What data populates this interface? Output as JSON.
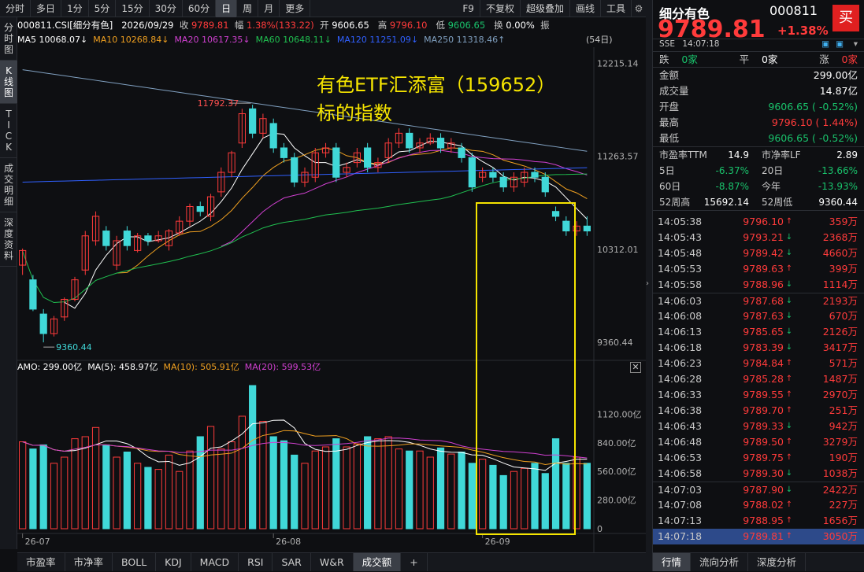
{
  "toolbar": {
    "tabs": [
      "分时",
      "多日",
      "1分",
      "5分",
      "15分",
      "30分",
      "60分",
      "日",
      "周",
      "月",
      "更多"
    ],
    "active_tab": "日",
    "right_items": [
      "F9",
      "不复权",
      "超级叠加",
      "画线",
      "工具"
    ]
  },
  "left_tabs": [
    "分时图",
    "K线图",
    "TICK",
    "成交明细",
    "深度资料"
  ],
  "info": {
    "code_name": "000811.CSI[细分有色]",
    "date": "2026/09/29",
    "close_label": "收",
    "close": "9789.81",
    "change_label": "幅",
    "change": "1.38%(133.22)",
    "open_label": "开",
    "open": "9606.65",
    "high_label": "高",
    "high": "9796.10",
    "low_label": "低",
    "low": "9606.65",
    "turnover_label": "换",
    "turnover": "0.00%",
    "amp_label": "振"
  },
  "ma": {
    "ma5": "MA5 10068.07↓",
    "ma10": "MA10 10268.84↓",
    "ma20": "MA20 10617.35↓",
    "ma60": "MA60 10648.11↓",
    "ma120": "MA120 11251.09↓",
    "ma250": "MA250 11318.46↑",
    "days": "(54日)"
  },
  "price_axis": [
    "12215.14",
    "11263.57",
    "10312.01",
    "9360.44"
  ],
  "high_mark": "11792.37",
  "low_mark": "9360.44",
  "amo": {
    "amo": "AMO: 299.00亿",
    "ma5": "MA(5): 458.97亿",
    "ma10": "MA(10): 505.91亿",
    "ma20": "MA(20): 599.53亿"
  },
  "vol_axis": [
    "1120.00亿",
    "840.00亿",
    "560.00亿",
    "280.00亿",
    "0"
  ],
  "date_axis": [
    "26-07",
    "26-08",
    "26-09"
  ],
  "annotation": {
    "line1": "有色ETF汇添富（159652）",
    "line2": "标的指数"
  },
  "bottom_tabs": [
    "市盈率",
    "市净率",
    "BOLL",
    "KDJ",
    "MACD",
    "RSI",
    "SAR",
    "W&R",
    "成交额"
  ],
  "colors": {
    "up": "#ff3b3b",
    "down": "#40d8d8",
    "ma5": "#ffffff",
    "ma10": "#f0a020",
    "ma20": "#d040d0",
    "ma60": "#20c050",
    "ma120": "#3060ff",
    "ma250": "#80a0c0",
    "highlight": "#f5e400"
  },
  "quote": {
    "name": "细分有色",
    "code": "000811",
    "price": "9789.81",
    "pct": "+1.38%",
    "buy": "买",
    "market": "SSE",
    "time": "14:07:18",
    "breadth": {
      "down_label": "跌",
      "down": "0家",
      "flat_label": "平",
      "flat": "0家",
      "up_label": "涨",
      "up": "0家"
    },
    "rows": [
      {
        "label": "金额",
        "value": "299.00亿",
        "cls": "white"
      },
      {
        "label": "成交量",
        "value": "14.87亿",
        "cls": "white"
      },
      {
        "label": "开盘",
        "value": "9606.65 ( -0.52%)",
        "cls": "green"
      },
      {
        "label": "最高",
        "value": "9796.10 ( 1.44%)",
        "cls": "red"
      },
      {
        "label": "最低",
        "value": "9606.65 ( -0.52%)",
        "cls": "green"
      }
    ],
    "stats": [
      {
        "l1": "市盈率TTM",
        "v1": "14.9",
        "c1": "white",
        "l2": "市净率LF",
        "v2": "2.89",
        "c2": "white"
      },
      {
        "l1": "5日",
        "v1": "-6.37%",
        "c1": "green",
        "l2": "20日",
        "v2": "-13.66%",
        "c2": "green"
      },
      {
        "l1": "60日",
        "v1": "-8.87%",
        "c1": "green",
        "l2": "今年",
        "v2": "-13.93%",
        "c2": "green"
      },
      {
        "l1": "52周高",
        "v1": "15692.14",
        "c1": "white",
        "l2": "52周低",
        "v2": "9360.44",
        "c2": "white"
      }
    ],
    "ticks": [
      {
        "t": "14:05:38",
        "p": "9796.10",
        "d": "up",
        "v": "359万"
      },
      {
        "t": "14:05:43",
        "p": "9793.21",
        "d": "down",
        "v": "2368万"
      },
      {
        "t": "14:05:48",
        "p": "9789.42",
        "d": "down",
        "v": "4660万"
      },
      {
        "t": "14:05:53",
        "p": "9789.63",
        "d": "up",
        "v": "399万"
      },
      {
        "t": "14:05:58",
        "p": "9788.96",
        "d": "down",
        "v": "1114万"
      },
      {
        "t": "14:06:03",
        "p": "9787.68",
        "d": "down",
        "v": "2193万"
      },
      {
        "t": "14:06:08",
        "p": "9787.63",
        "d": "down",
        "v": "670万"
      },
      {
        "t": "14:06:13",
        "p": "9785.65",
        "d": "down",
        "v": "2126万"
      },
      {
        "t": "14:06:18",
        "p": "9783.39",
        "d": "down",
        "v": "3417万"
      },
      {
        "t": "14:06:23",
        "p": "9784.84",
        "d": "up",
        "v": "571万"
      },
      {
        "t": "14:06:28",
        "p": "9785.28",
        "d": "up",
        "v": "1487万"
      },
      {
        "t": "14:06:33",
        "p": "9789.55",
        "d": "up",
        "v": "2970万"
      },
      {
        "t": "14:06:38",
        "p": "9789.70",
        "d": "up",
        "v": "251万"
      },
      {
        "t": "14:06:43",
        "p": "9789.33",
        "d": "down",
        "v": "942万"
      },
      {
        "t": "14:06:48",
        "p": "9789.50",
        "d": "up",
        "v": "3279万"
      },
      {
        "t": "14:06:53",
        "p": "9789.75",
        "d": "up",
        "v": "190万"
      },
      {
        "t": "14:06:58",
        "p": "9789.30",
        "d": "down",
        "v": "1038万"
      },
      {
        "t": "14:07:03",
        "p": "9787.90",
        "d": "down",
        "v": "2422万"
      },
      {
        "t": "14:07:08",
        "p": "9788.02",
        "d": "up",
        "v": "227万"
      },
      {
        "t": "14:07:13",
        "p": "9788.95",
        "d": "up",
        "v": "1656万"
      },
      {
        "t": "14:07:18",
        "p": "9789.81",
        "d": "up",
        "v": "3050万"
      }
    ],
    "tabs": [
      "行情",
      "流向分析",
      "深度分析"
    ]
  },
  "chart_data": {
    "type": "candlestick",
    "ylim": [
      9200,
      12300
    ],
    "vol_ylim": [
      0,
      1400
    ],
    "candles": [
      [
        10150,
        10300,
        10050,
        10320,
        850
      ],
      [
        10000,
        9700,
        9680,
        10050,
        780
      ],
      [
        9650,
        9450,
        9360,
        9700,
        820
      ],
      [
        9450,
        9600,
        9420,
        9630,
        640
      ],
      [
        9620,
        9800,
        9580,
        9820,
        700
      ],
      [
        9800,
        10000,
        9780,
        10030,
        880
      ],
      [
        10100,
        10450,
        10050,
        10500,
        900
      ],
      [
        10400,
        10650,
        10350,
        10700,
        990
      ],
      [
        10500,
        10350,
        10300,
        10550,
        820
      ],
      [
        10150,
        10400,
        10100,
        10450,
        700
      ],
      [
        10500,
        10350,
        10300,
        10550,
        750
      ],
      [
        10300,
        10450,
        10280,
        10480,
        640
      ],
      [
        10450,
        10400,
        10350,
        10480,
        600
      ],
      [
        10400,
        10450,
        10380,
        10500,
        580
      ],
      [
        10350,
        10500,
        10300,
        10520,
        720
      ],
      [
        10480,
        10600,
        10450,
        10650,
        560
      ],
      [
        10600,
        10750,
        10550,
        10780,
        760
      ],
      [
        10750,
        10700,
        10650,
        10800,
        900
      ],
      [
        10650,
        10850,
        10600,
        10880,
        1000
      ],
      [
        10900,
        11100,
        10850,
        11150,
        780
      ],
      [
        11100,
        11300,
        11050,
        11320,
        850
      ],
      [
        11400,
        11700,
        11350,
        11750,
        1100
      ],
      [
        11750,
        11500,
        11450,
        11792,
        1400
      ],
      [
        11500,
        11650,
        11450,
        11700,
        1050
      ],
      [
        11600,
        11350,
        11300,
        11650,
        900
      ],
      [
        11350,
        11250,
        11200,
        11400,
        860
      ],
      [
        11250,
        11000,
        10950,
        11300,
        720
      ],
      [
        11000,
        11100,
        10950,
        11150,
        640
      ],
      [
        11050,
        11300,
        11000,
        11350,
        760
      ],
      [
        11300,
        11350,
        11250,
        11400,
        800
      ],
      [
        11350,
        11050,
        11000,
        11400,
        880
      ],
      [
        11100,
        11150,
        11050,
        11200,
        800
      ],
      [
        11200,
        11300,
        11150,
        11350,
        830
      ],
      [
        11350,
        11150,
        11100,
        11400,
        900
      ],
      [
        11150,
        11200,
        11100,
        11250,
        880
      ],
      [
        11250,
        11400,
        11200,
        11450,
        900
      ],
      [
        11400,
        11500,
        11350,
        11550,
        780
      ],
      [
        11500,
        11350,
        11300,
        11550,
        760
      ],
      [
        11350,
        11400,
        11300,
        11450,
        760
      ],
      [
        11400,
        11450,
        11380,
        11500,
        700
      ],
      [
        11450,
        11350,
        11300,
        11500,
        790
      ],
      [
        11350,
        11400,
        11300,
        11450,
        730
      ],
      [
        11350,
        11250,
        11200,
        11400,
        750
      ],
      [
        11250,
        10950,
        10900,
        11300,
        640
      ],
      [
        11050,
        11100,
        11000,
        11150,
        680
      ],
      [
        11100,
        11050,
        11000,
        11150,
        620
      ],
      [
        11050,
        10950,
        10900,
        11100,
        520
      ],
      [
        10950,
        11050,
        10900,
        11100,
        560
      ],
      [
        11000,
        11100,
        10950,
        11150,
        590
      ],
      [
        11100,
        11050,
        11000,
        11150,
        640
      ],
      [
        11050,
        10900,
        10850,
        11100,
        540
      ],
      [
        10700,
        10650,
        10600,
        10750,
        880
      ],
      [
        10600,
        10500,
        10450,
        10650,
        640
      ],
      [
        10500,
        10550,
        10450,
        10600,
        700
      ],
      [
        10550,
        10500,
        10450,
        10650,
        640
      ]
    ]
  }
}
